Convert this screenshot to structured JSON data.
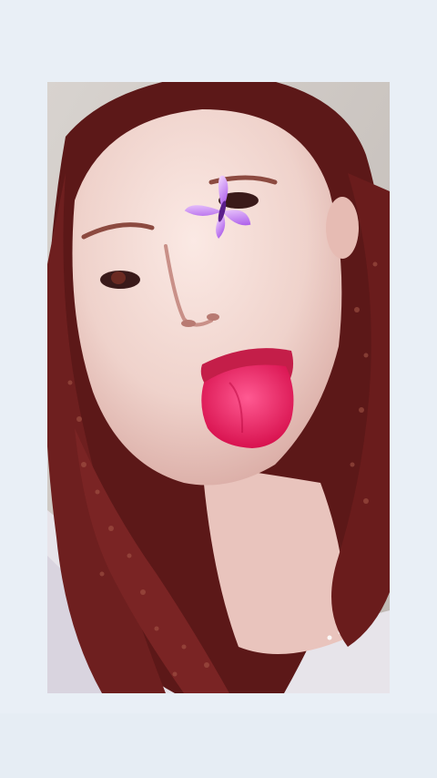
{
  "photo": {
    "description_icon": "portrait-photo",
    "sticker": "butterfly-icon",
    "colors": {
      "background": "#e9eff6",
      "hair": "#6e1f1f",
      "skin": "#efd6cf",
      "tongue": "#e8356d",
      "butterfly": "#c27bf0",
      "wall": "#cfc9c4"
    }
  }
}
